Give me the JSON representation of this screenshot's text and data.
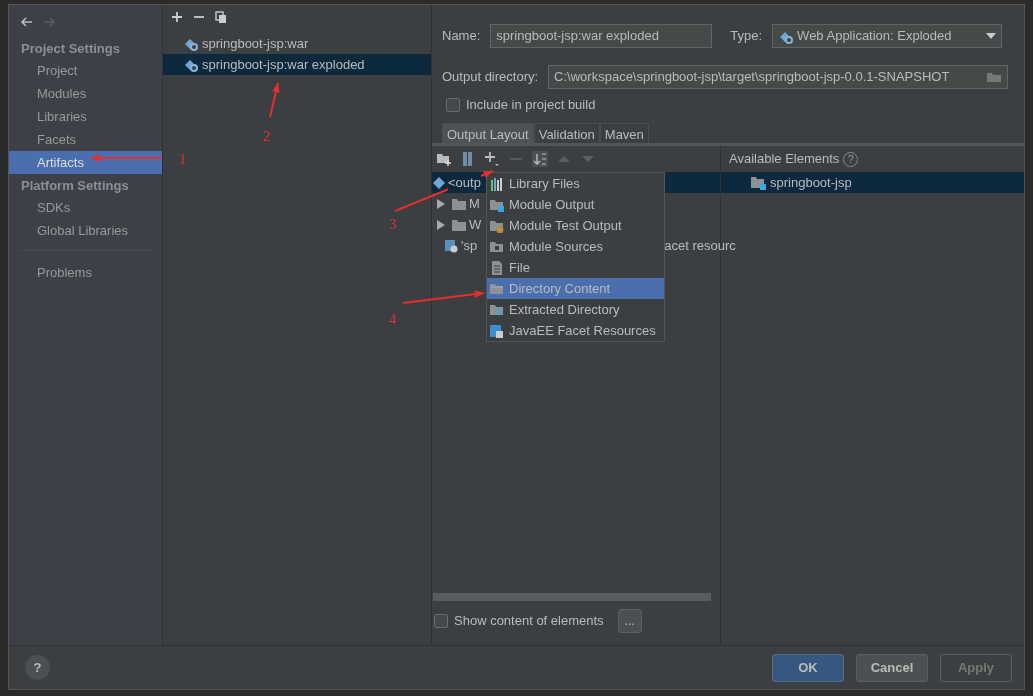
{
  "nav_buttons": [
    {
      "kind": "back",
      "disabled": false
    },
    {
      "kind": "forward",
      "disabled": true
    }
  ],
  "sidebar": {
    "sections": [
      {
        "title": "Project Settings",
        "items": [
          {
            "label": "Project",
            "selected": false
          },
          {
            "label": "Modules",
            "selected": false
          },
          {
            "label": "Libraries",
            "selected": false
          },
          {
            "label": "Facets",
            "selected": false
          },
          {
            "label": "Artifacts",
            "selected": true
          }
        ]
      },
      {
        "title": "Platform Settings",
        "items": [
          {
            "label": "SDKs",
            "selected": false
          },
          {
            "label": "Global Libraries",
            "selected": false
          }
        ]
      }
    ],
    "footer_items": [
      {
        "label": "Problems",
        "selected": false
      }
    ]
  },
  "artifacts": {
    "items": [
      {
        "label": "springboot-jsp:war",
        "selected": false
      },
      {
        "label": "springboot-jsp:war exploded",
        "selected": true
      }
    ]
  },
  "details": {
    "name_label": "Name:",
    "name_value": "springboot-jsp:war exploded",
    "type_label": "Type:",
    "type_value": "Web Application: Exploded",
    "output_label": "Output directory:",
    "output_value": "C:\\workspace\\springboot-jsp\\target\\springboot-jsp-0.0.1-SNAPSHOT",
    "include": {
      "label": "Include in project build",
      "checked": false
    },
    "tabs": [
      {
        "label": "Output Layout",
        "selected": true
      },
      {
        "label": "Validation",
        "selected": false
      },
      {
        "label": "Maven",
        "selected": false
      }
    ],
    "toolbar": [
      {
        "kind": "new-folder",
        "disabled": false
      },
      {
        "kind": "archive",
        "disabled": false
      },
      {
        "kind": "add",
        "disabled": false
      },
      {
        "kind": "remove",
        "disabled": true
      },
      {
        "kind": "sort",
        "disabled": false
      },
      {
        "kind": "up",
        "disabled": true
      },
      {
        "kind": "down",
        "disabled": true
      }
    ],
    "available_title": "Available Elements",
    "available_help": "?",
    "layout_tree": [
      {
        "kind": "root",
        "text": "<outp",
        "selected": true
      },
      {
        "kind": "folder",
        "text": "M",
        "expanded": false,
        "selected": false
      },
      {
        "kind": "folder",
        "text": "W",
        "expanded": false,
        "selected": false
      },
      {
        "kind": "facet",
        "text": "'sp",
        "tail": "acet resourc",
        "selected": false
      }
    ],
    "available_tree": [
      {
        "label": "springboot-jsp",
        "selected": true
      }
    ],
    "show_content": {
      "label": "Show content of elements",
      "checked": false
    },
    "more_button": "..."
  },
  "popup_menu": [
    {
      "kind": "library",
      "label": "Library Files",
      "selected": false
    },
    {
      "kind": "module-output",
      "label": "Module Output",
      "selected": false
    },
    {
      "kind": "test-output",
      "label": "Module Test Output",
      "selected": false
    },
    {
      "kind": "sources",
      "label": "Module Sources",
      "selected": false
    },
    {
      "kind": "file",
      "label": "File",
      "selected": false
    },
    {
      "kind": "directory",
      "label": "Directory Content",
      "selected": true
    },
    {
      "kind": "extracted",
      "label": "Extracted Directory",
      "selected": false
    },
    {
      "kind": "facet",
      "label": "JavaEE Facet Resources",
      "selected": false
    }
  ],
  "help_button": "?",
  "buttons": [
    {
      "label": "OK",
      "primary": true,
      "disabled": false
    },
    {
      "label": "Cancel",
      "primary": false,
      "disabled": false
    },
    {
      "label": "Apply",
      "primary": false,
      "disabled": true
    }
  ],
  "annotations": [
    {
      "label": "1"
    },
    {
      "label": "2"
    },
    {
      "label": "3"
    },
    {
      "label": "4"
    }
  ]
}
